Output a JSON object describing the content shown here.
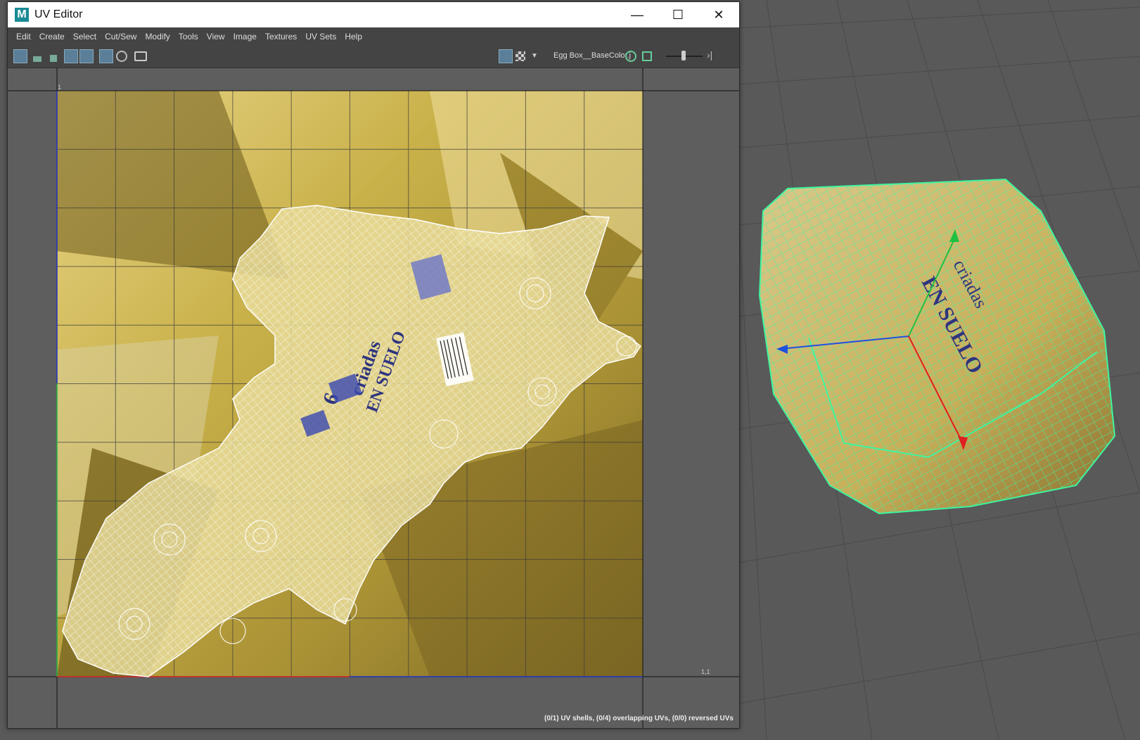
{
  "window": {
    "title": "UV Editor",
    "app_icon_letter": "M",
    "controls": {
      "minimize": "—",
      "maximize": "☐",
      "close": "✕"
    }
  },
  "menu": {
    "items": [
      "Edit",
      "Create",
      "Select",
      "Cut/Sew",
      "Modify",
      "Tools",
      "View",
      "Image",
      "Textures",
      "UV Sets",
      "Help"
    ]
  },
  "toolbar": {
    "texture_name": "Egg Box__BaseColor.j",
    "icons": [
      "uv-mode-icon",
      "stacked-shells-icon",
      "step-icon",
      "frame-icon",
      "frame-selected-icon",
      "grid-icon",
      "sphere-icon",
      "snapshot-icon",
      "image-display-icon",
      "checker-icon",
      "dropdown-icon",
      "sync-icon",
      "image-icon",
      "exposure-slider",
      "more-icon"
    ]
  },
  "uv_view": {
    "tick_top_left": "1",
    "tick_bottom_right": "1,1",
    "status": "(0/1) UV shells, (0/4) overlapping UVs, (0/0) reversed UVs"
  },
  "label_texts": {
    "count": "6",
    "line1": "criadas",
    "line2": "EN SUELO"
  },
  "colors": {
    "texture_base": "#c8b14a",
    "wire_uv": "#ffffff",
    "wire_3d": "#3ef5a0",
    "axis_x": "#e02020",
    "axis_y": "#20c040",
    "axis_z": "#2050e0"
  }
}
